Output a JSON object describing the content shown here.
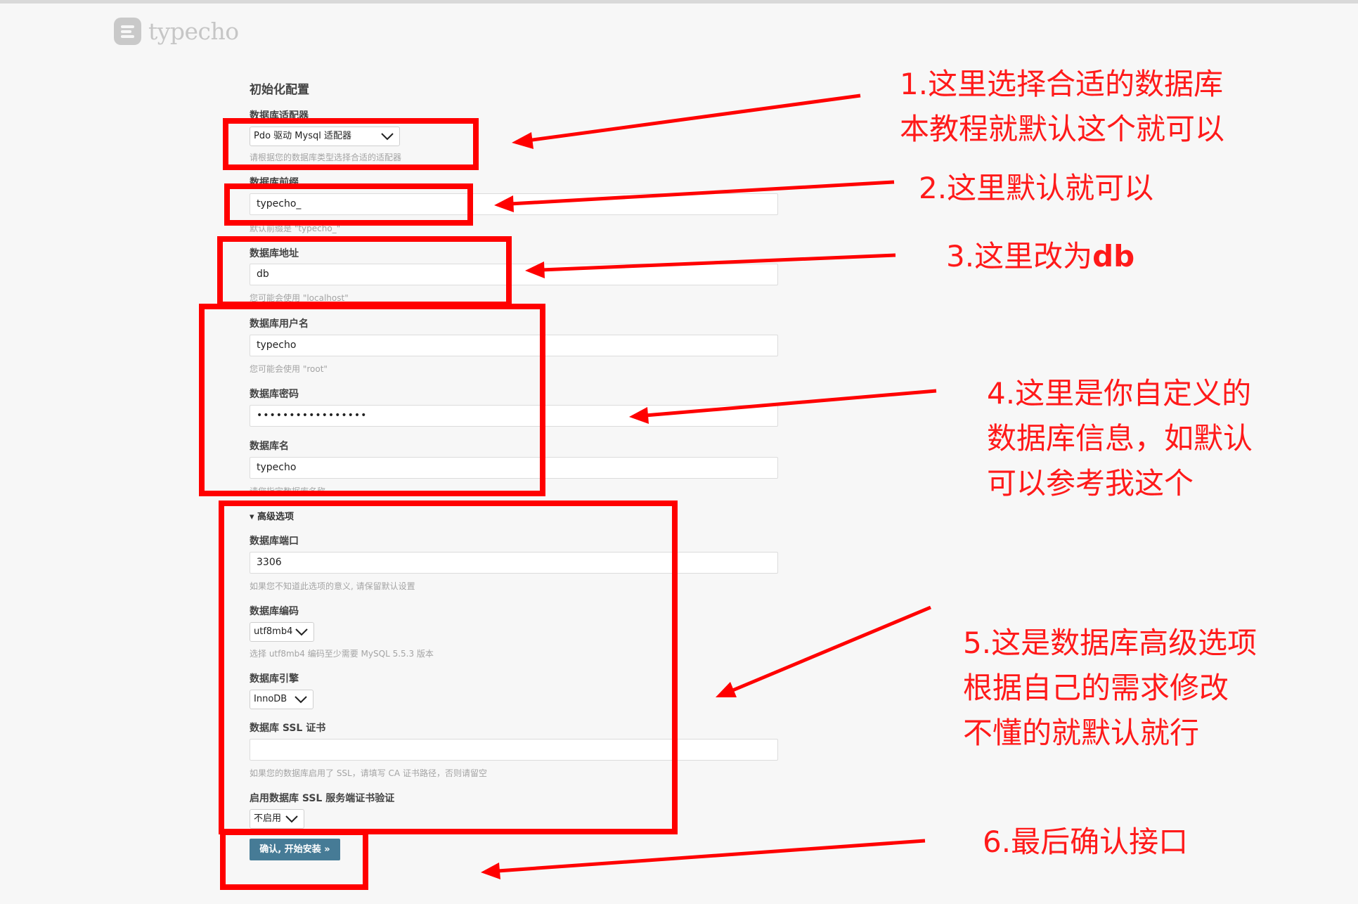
{
  "logo": {
    "text": "typecho"
  },
  "form": {
    "title": "初始化配置",
    "adapter": {
      "label": "数据库适配器",
      "value": "Pdo 驱动 Mysql 适配器",
      "hint": "请根据您的数据库类型选择合适的适配器"
    },
    "prefix": {
      "label": "数据库前缀",
      "value": "typecho_",
      "hint": "默认前缀是 \"typecho_\""
    },
    "host": {
      "label": "数据库地址",
      "value": "db",
      "hint": "您可能会使用 \"localhost\""
    },
    "user": {
      "label": "数据库用户名",
      "value": "typecho",
      "hint": "您可能会使用 \"root\""
    },
    "password": {
      "label": "数据库密码",
      "value": "•••••••••••••••••"
    },
    "dbname": {
      "label": "数据库名",
      "value": "typecho",
      "hint": "请您指定数据库名称"
    },
    "advanced": {
      "label": "▾ 高级选项"
    },
    "port": {
      "label": "数据库端口",
      "value": "3306",
      "hint": "如果您不知道此选项的意义, 请保留默认设置"
    },
    "charset": {
      "label": "数据库编码",
      "value": "utf8mb4",
      "hint": "选择 utf8mb4 编码至少需要 MySQL 5.5.3 版本"
    },
    "engine": {
      "label": "数据库引擎",
      "value": "InnoDB"
    },
    "ssl_cert": {
      "label": "数据库 SSL 证书",
      "value": "",
      "hint": "如果您的数据库启用了 SSL，请填写 CA 证书路径，否则请留空"
    },
    "ssl_verify": {
      "label": "启用数据库 SSL 服务端证书验证",
      "value": "不启用"
    },
    "submit": "确认, 开始安装 »"
  },
  "annotations": {
    "note1_line1": "1.这里选择合适的数据库",
    "note1_line2": "本教程就默认这个就可以",
    "note2": "2.这里默认就可以",
    "note3_prefix": "3.这里改为",
    "note3_bold": "db",
    "note4_line1": "4.这里是你自定义的",
    "note4_line2": "数据库信息，如默认",
    "note4_line3": "可以参考我这个",
    "note5_line1": "5.这是数据库高级选项",
    "note5_line2": "根据自己的需求修改",
    "note5_line3": "不懂的就默认就行",
    "note6": "6.最后确认接口"
  },
  "colors": {
    "annotation": "#ff0000",
    "submit_bg": "#467b96",
    "background": "#f7f7f7"
  }
}
